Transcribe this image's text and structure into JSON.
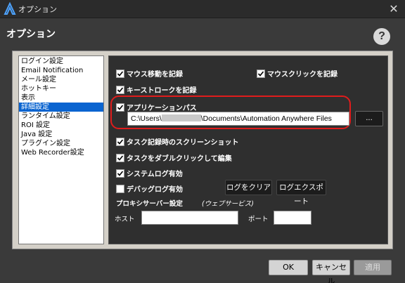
{
  "window": {
    "title": "オプション",
    "close_glyph": "✕"
  },
  "header": {
    "title": "オプション",
    "help_glyph": "?"
  },
  "categories": [
    {
      "label": "ログイン設定",
      "selected": false
    },
    {
      "label": "Email Notification",
      "selected": false
    },
    {
      "label": "メール設定",
      "selected": false
    },
    {
      "label": "ホットキー",
      "selected": false
    },
    {
      "label": "表示",
      "selected": false
    },
    {
      "label": "詳細設定",
      "selected": true
    },
    {
      "label": "ランタイム設定",
      "selected": false
    },
    {
      "label": "ROI 設定",
      "selected": false
    },
    {
      "label": "Java 設定",
      "selected": false
    },
    {
      "label": "プラグイン設定",
      "selected": false
    },
    {
      "label": "Web Recorder設定",
      "selected": false
    }
  ],
  "settings": {
    "record_mouse_move": {
      "label": "マウス移動を記録",
      "checked": true
    },
    "record_mouse_click": {
      "label": "マウスクリックを記録",
      "checked": true
    },
    "record_keystroke": {
      "label": "キーストロークを記録",
      "checked": true
    },
    "app_path": {
      "label": "アプリケーションパス",
      "checked": true,
      "value_prefix": "C:\\Users\\",
      "value_suffix": "\\Documents\\Automation Anywhere Files",
      "browse_label": "..."
    },
    "screenshot_on_record": {
      "label": "タスク記録時のスクリーンショット",
      "checked": true
    },
    "double_click_edit": {
      "label": "タスクをダブルクリックして編集",
      "checked": true
    },
    "system_log": {
      "label": "システムログ有効",
      "checked": true
    },
    "debug_log": {
      "label": "デバッグログ有効",
      "checked": false
    },
    "clear_log_button": "ログをクリア",
    "export_log_button": "ログエクスポート",
    "proxy": {
      "title": "プロキシサーバー設定",
      "subtitle": "(ウェブサービス)",
      "host_label": "ホスト",
      "host_value": "",
      "port_label": "ポート",
      "port_value": ""
    }
  },
  "footer": {
    "ok_label": "OK",
    "cancel_label": "キャンセル",
    "apply_label": "適用"
  },
  "colors": {
    "accent_selection": "#0a64d0",
    "highlight_red": "#e01c1c",
    "background": "#3a3a3a"
  }
}
